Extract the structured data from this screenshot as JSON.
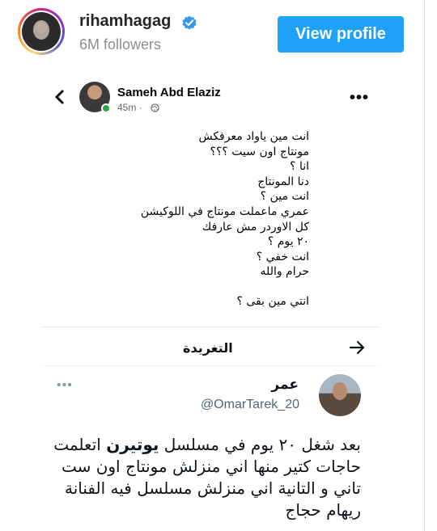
{
  "profile": {
    "username": "rihamhagag",
    "followers": "6M followers",
    "view_profile_label": "View profile",
    "verified_icon": "verified-badge-icon",
    "accent_color": "#1ea1f7"
  },
  "facebook_post": {
    "author": "Sameh Abd Elaziz",
    "time": "45m ·",
    "lines": [
      "انت مين ياواد معرفكش",
      "مونتاج اون سيت ؟؟؟",
      "انا ؟",
      "دنا المونتاج",
      "انت مين ؟",
      "عمري ماعملت مونتاج في اللوكيشن",
      "كل الاوردر مش عارفك",
      "٢٠ يوم ؟",
      "انت خفي ؟",
      "حرام والله"
    ],
    "last_line": "انتي مين بقى ؟"
  },
  "tweet_bar": {
    "title": "التغريدة"
  },
  "tweet": {
    "name": "عمر",
    "handle": "@OmarTarek_20",
    "line1_before": "بعد شغل ٢٠ يوم في مسلسل ",
    "line1_bold": "يوتيرن",
    "line1_after": " اتعلمت",
    "line2": "حاجات كتير منها اني منزلش مونتاج اون ست",
    "line3": "تاني و التانية اني منزلش مسلسل فيه الفنانة",
    "line4": "ريهام حجاج"
  }
}
